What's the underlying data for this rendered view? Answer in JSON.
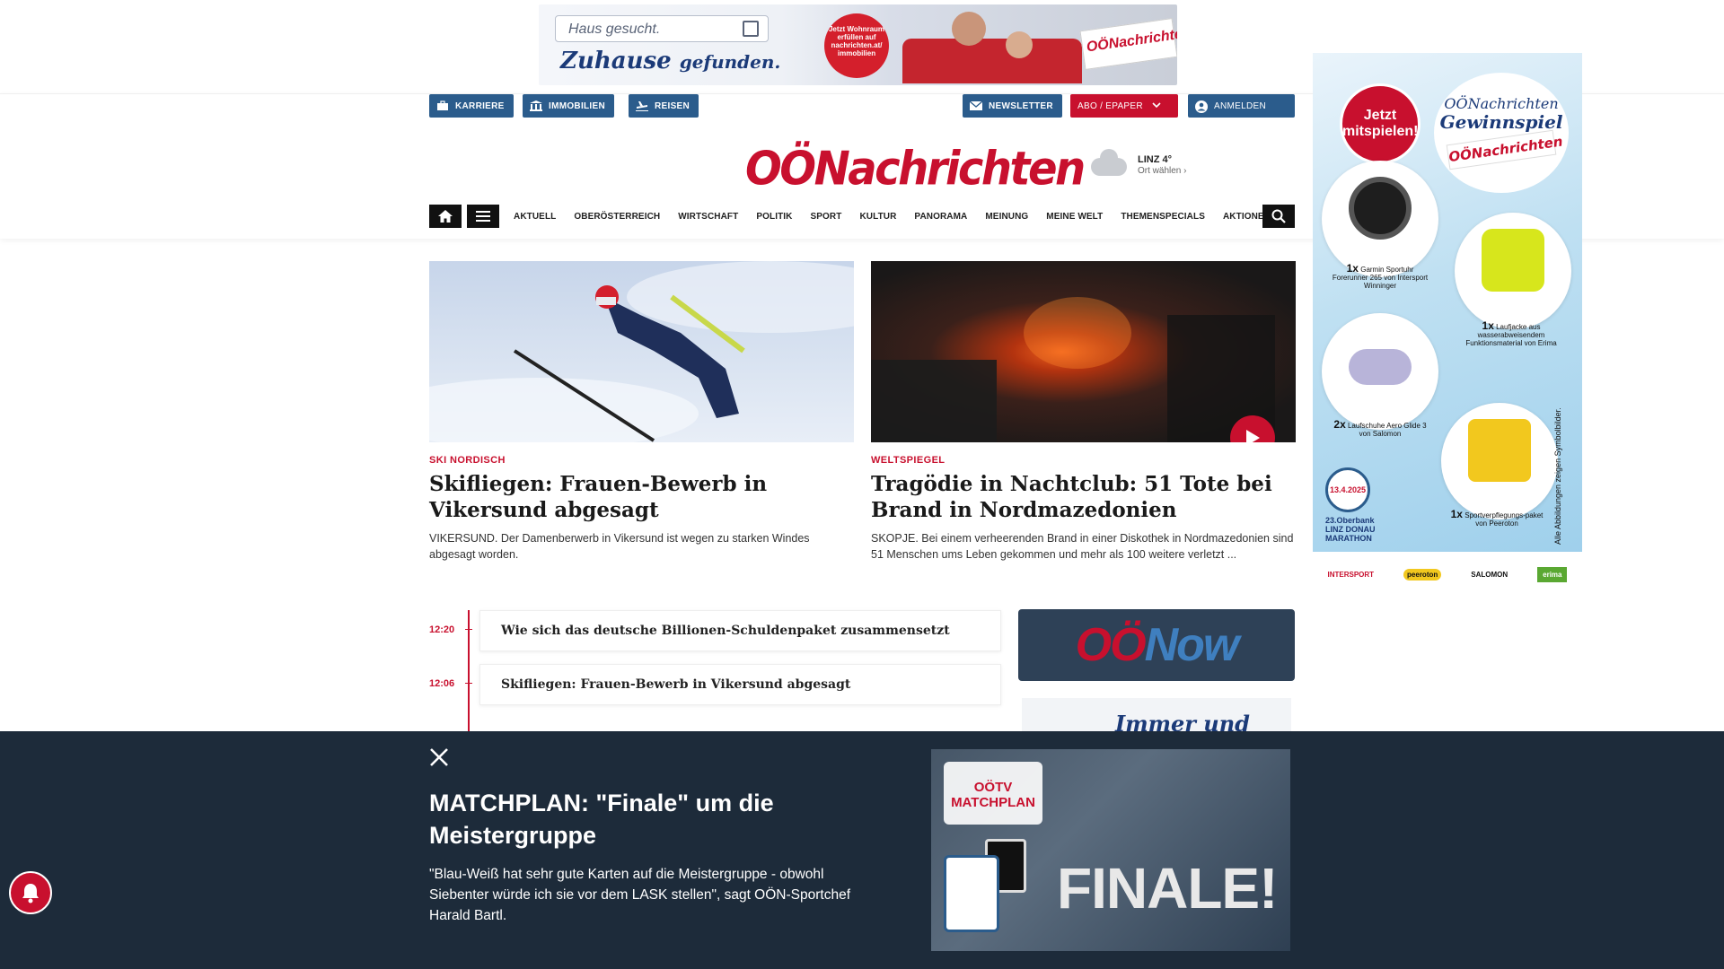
{
  "top_ad": {
    "search_placeholder": "Haus gesucht.",
    "slogan_main": "Zuhause",
    "slogan_tail": "gefunden.",
    "badge_text": "Jetzt Wohnraum erfüllen auf nachrichten.at/ immobilien",
    "paper_brand": "OÖNachrichten"
  },
  "header": {
    "buttons_left": [
      {
        "label": "KARRIERE",
        "icon": "briefcase-icon"
      },
      {
        "label": "IMMOBILIEN",
        "icon": "building-icon"
      },
      {
        "label": "REISEN",
        "icon": "plane-icon"
      }
    ],
    "newsletter_label": "NEWSLETTER",
    "abo_label": "ABO / EPAPER",
    "login_label": "ANMELDEN",
    "logo": "OÖNachrichten",
    "weather": {
      "city": "LINZ 4°",
      "action": "Ort wählen"
    }
  },
  "nav": {
    "items": [
      "AKTUELL",
      "OBERÖSTERREICH",
      "WIRTSCHAFT",
      "POLITIK",
      "SPORT",
      "KULTUR",
      "PANORAMA",
      "MEINUNG",
      "MEINE WELT",
      "THEMENSPECIALS",
      "AKTIONEN"
    ]
  },
  "articles": [
    {
      "kicker": "SKI NORDISCH",
      "title": "Skifliegen: Frauen-Bewerb in Vikersund abgesagt",
      "teaser": "VIKERSUND. Der Damenberwerb in Vikersund ist wegen zu starken Windes abgesagt worden."
    },
    {
      "kicker": "WELTSPIEGEL",
      "title": "Tragödie in Nachtclub: 51 Tote bei Brand in Nordmazedonien",
      "teaser": "SKOPJE. Bei einem verheerenden Brand in einer Diskothek in Nordmazedonien sind 51 Menschen ums Leben gekommen und mehr als 100 weitere verletzt ..."
    }
  ],
  "ticker": [
    {
      "time": "12:20",
      "title": "Wie sich das deutsche Billionen-Schuldenpaket zusammensetzt"
    },
    {
      "time": "12:06",
      "title": "Skifliegen: Frauen-Bewerb in Vikersund abgesagt"
    }
  ],
  "oenow": {
    "part1": "OÖ",
    "part2": "Now",
    "teaser": "Immer und überall"
  },
  "side_ad": {
    "cta": "Jetzt mitspielen!",
    "brand_line1": "OÖNachrichten",
    "brand_line2": "Gewinnspiel",
    "paper": "OÖNachrichten",
    "prizes": [
      {
        "count": "1x",
        "text": "Garmin Sportuhr Forerunner 265 von Intersport Winninger"
      },
      {
        "count": "1x",
        "text": "Laufjacke aus wasserabweisendem Funktionsmaterial von Erima"
      },
      {
        "count": "2x",
        "text": "Laufschuhe Aero Glide 3 von Salomon"
      },
      {
        "count": "1x",
        "text": "Sportverpflegungs-paket von Peeroton"
      }
    ],
    "marathon_date": "13.4.2025",
    "marathon_name": "23.Oberbank LINZ DONAU MARATHON",
    "disclaimer": "Alle Abbildungen zeigen Symbolbilder.",
    "sponsors": [
      "INTERSPORT",
      "peeroton",
      "SALOMON",
      "erima"
    ]
  },
  "overlay": {
    "headline": "MATCHPLAN: \"Finale\" um die Meistergruppe",
    "body": "\"Blau-Weiß hat sehr gute Karten auf die Meistergruppe - obwohl Siebenter würde ich sie vor dem LASK stellen\", sagt OÖN-Sportchef Harald Bartl.",
    "thumb_brand": "OÖTV MATCHPLAN",
    "thumb_text": "FINALE!"
  },
  "colors": {
    "brand_red": "#c8102e",
    "brand_blue": "#2b5c8c",
    "overlay_bg": "#1d2b3a"
  }
}
